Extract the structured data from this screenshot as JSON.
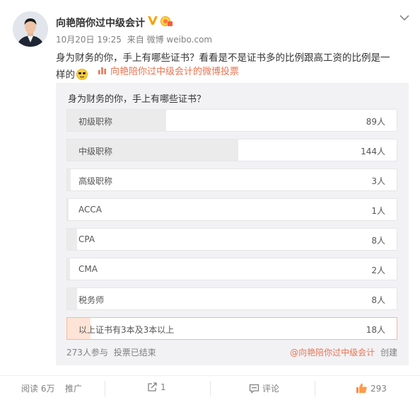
{
  "post": {
    "author": "向艳陪你过中级会计",
    "time": "10月20日 19:25",
    "source": "来自 微博 weibo.com",
    "text_line1": "身为财务的你，手上有哪些证书？看看是不是证书多的比例跟高工资的比例是一",
    "text_line2": "样的",
    "poll_link": "向艳陪你过中级会计的微博投票"
  },
  "poll": {
    "question": "身为财务的你，手上有哪些证书？",
    "options": [
      {
        "label": "初级职称",
        "count": "89人",
        "share": 0.3
      },
      {
        "label": "中级职称",
        "count": "144人",
        "share": 0.52
      },
      {
        "label": "高级职称",
        "count": "3人",
        "share": 0.01
      },
      {
        "label": "ACCA",
        "count": "1人",
        "share": 0.005
      },
      {
        "label": "CPA",
        "count": "8人",
        "share": 0.03
      },
      {
        "label": "CMA",
        "count": "2人",
        "share": 0.008
      },
      {
        "label": "税务师",
        "count": "8人",
        "share": 0.03
      },
      {
        "label": "以上证书有3本及3本以上",
        "count": "18人",
        "share": 0.07,
        "selected": true
      }
    ],
    "participants": "273人参与",
    "status": "投票已结束",
    "creator_link": "@向艳陪你过中级会计",
    "creator_suffix": "创建"
  },
  "footer": {
    "reads": "阅读 6万",
    "promote": "推广",
    "repost_count": "1",
    "comment_label": "评论",
    "like_count": "293"
  },
  "colors": {
    "accent": "#eb7350",
    "muted": "#808080",
    "poll_bg": "#f2f2f5",
    "bar_fill": "#ebebeb",
    "selected_fill": "#fde4d6"
  },
  "icons": [
    "verified-v-icon",
    "level-badge-icon",
    "chevron-down-icon",
    "emoji-icon",
    "poll-icon",
    "repost-icon",
    "comment-icon",
    "like-icon"
  ]
}
